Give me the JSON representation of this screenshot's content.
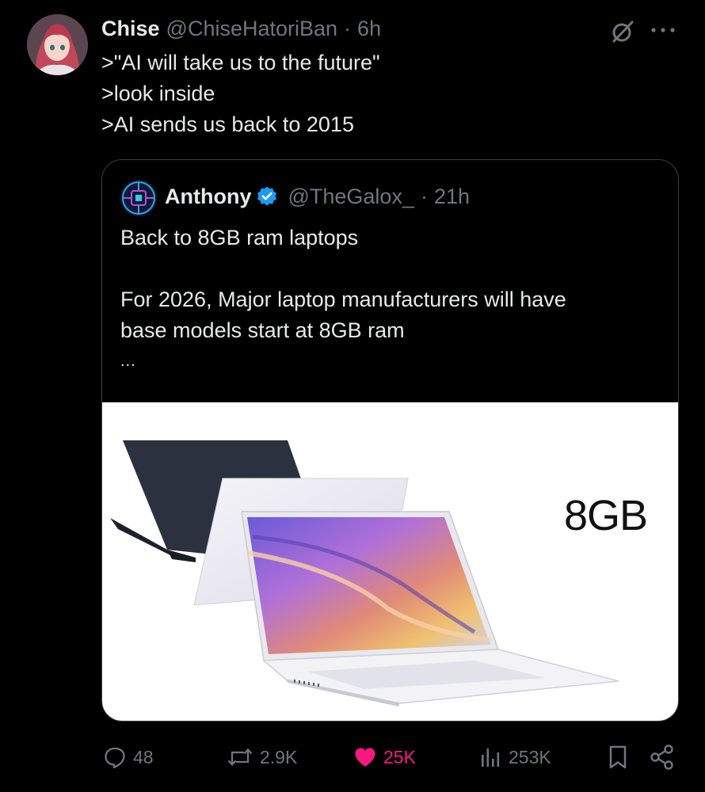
{
  "author": {
    "name": "Chise",
    "handle": "@ChiseHatoriBan",
    "separator": "·",
    "time": "6h"
  },
  "tweet": {
    "lines": [
      ">\"AI will take us to the future\"",
      ">look inside",
      ">AI sends us back to 2015"
    ]
  },
  "quote": {
    "name": "Anthony",
    "handle": "@TheGalox_",
    "separator": "·",
    "time": "21h",
    "lines": [
      "Back to 8GB ram laptops",
      "",
      "For 2026, Major laptop manufacturers will have",
      "base models start at 8GB ram",
      "..."
    ],
    "image": {
      "label": "8GB"
    }
  },
  "actions": {
    "replies": "48",
    "reposts": "2.9K",
    "likes": "25K",
    "views": "253K"
  },
  "icons": {
    "grok": "grok-icon",
    "more": "more-icon",
    "verified": "verified-badge-icon",
    "reply": "reply-icon",
    "repost": "repost-icon",
    "like": "heart-icon",
    "views": "views-icon",
    "bookmark": "bookmark-icon",
    "share": "share-icon"
  },
  "colors": {
    "background": "#000000",
    "text": "#e7e9ea",
    "muted": "#71767b",
    "like": "#f91880",
    "verified": "#1d9bf0",
    "border": "#3a3d41"
  }
}
